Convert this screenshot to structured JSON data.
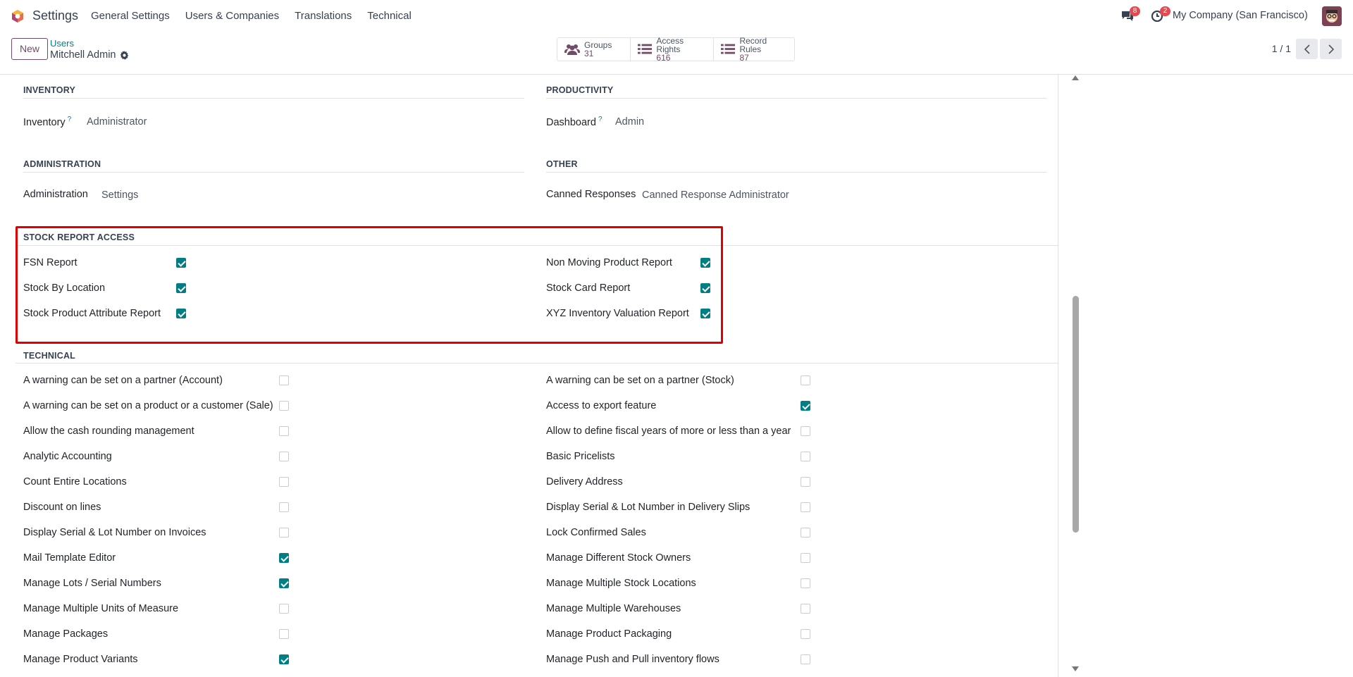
{
  "app": {
    "name": "Settings",
    "logo_icon": "odoo-logo-icon",
    "accent": "#714b67",
    "teal": "#017e84"
  },
  "menu": [
    "General Settings",
    "Users & Companies",
    "Translations",
    "Technical"
  ],
  "systray": {
    "messages_count": "8",
    "activities_count": "2",
    "company": "My Company (San Francisco)"
  },
  "control": {
    "new_label": "New",
    "breadcrumb_parent": "Users",
    "breadcrumb_current": "Mitchell Admin",
    "stats": [
      {
        "label": "Groups",
        "value": "31"
      },
      {
        "label": "Access Rights",
        "value": "616"
      },
      {
        "label": "Record Rules",
        "value": "87"
      }
    ],
    "pager": "1 / 1"
  },
  "sections": {
    "inventory": {
      "title": "INVENTORY",
      "label": "Inventory",
      "tip": "?",
      "value": "Administrator"
    },
    "productivity": {
      "title": "PRODUCTIVITY",
      "label": "Dashboard",
      "tip": "?",
      "value": "Admin"
    },
    "administration": {
      "title": "ADMINISTRATION",
      "label": "Administration",
      "value": "Settings"
    },
    "other": {
      "title": "OTHER",
      "label": "Canned Responses",
      "value": "Canned Response Administrator"
    },
    "stock_report": {
      "title": "STOCK REPORT ACCESS",
      "left": [
        {
          "label": "FSN Report",
          "checked": true
        },
        {
          "label": "Stock By Location",
          "checked": true
        },
        {
          "label": "Stock Product Attribute Report",
          "checked": true
        }
      ],
      "right": [
        {
          "label": "Non Moving Product Report",
          "checked": true
        },
        {
          "label": "Stock Card Report",
          "checked": true
        },
        {
          "label": "XYZ Inventory Valuation Report",
          "checked": true
        }
      ]
    },
    "technical": {
      "title": "TECHNICAL",
      "left": [
        {
          "label": "A warning can be set on a partner (Account)",
          "checked": false
        },
        {
          "label": "A warning can be set on a product or a customer (Sale)",
          "checked": false
        },
        {
          "label": "Allow the cash rounding management",
          "checked": false
        },
        {
          "label": "Analytic Accounting",
          "checked": false
        },
        {
          "label": "Count Entire Locations",
          "checked": false
        },
        {
          "label": "Discount on lines",
          "checked": false
        },
        {
          "label": "Display Serial & Lot Number on Invoices",
          "checked": false
        },
        {
          "label": "Mail Template Editor",
          "checked": true
        },
        {
          "label": "Manage Lots / Serial Numbers",
          "checked": true
        },
        {
          "label": "Manage Multiple Units of Measure",
          "checked": false
        },
        {
          "label": "Manage Packages",
          "checked": false
        },
        {
          "label": "Manage Product Variants",
          "checked": true
        }
      ],
      "right": [
        {
          "label": "A warning can be set on a partner (Stock)",
          "checked": false
        },
        {
          "label": "Access to export feature",
          "checked": true
        },
        {
          "label": "Allow to define fiscal years of more or less than a year",
          "checked": false
        },
        {
          "label": "Basic Pricelists",
          "checked": false
        },
        {
          "label": "Delivery Address",
          "checked": false
        },
        {
          "label": "Display Serial & Lot Number in Delivery Slips",
          "checked": false
        },
        {
          "label": "Lock Confirmed Sales",
          "checked": false
        },
        {
          "label": "Manage Different Stock Owners",
          "checked": false
        },
        {
          "label": "Manage Multiple Stock Locations",
          "checked": false
        },
        {
          "label": "Manage Multiple Warehouses",
          "checked": false
        },
        {
          "label": "Manage Product Packaging",
          "checked": false
        },
        {
          "label": "Manage Push and Pull inventory flows",
          "checked": false
        }
      ]
    }
  }
}
